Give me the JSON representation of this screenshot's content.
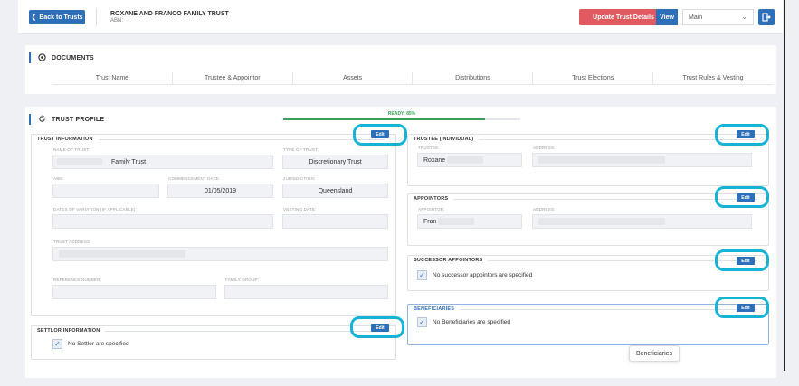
{
  "header": {
    "back_label": "Back to Trusts",
    "trust_title": "ROXANE AND FRANCO FAMILY TRUST",
    "abn_label": "ABN:",
    "update_label": "Update Trust Details",
    "view_label": "View",
    "view_selected": "Main"
  },
  "documents": {
    "title": "DOCUMENTS",
    "tabs": [
      "Trust Name",
      "Trustee & Appointor",
      "Assets",
      "Distributions",
      "Trust Elections",
      "Trust Rules & Vesting"
    ]
  },
  "profile": {
    "title": "TRUST PROFILE",
    "ready_label": "READY: 85%",
    "ready_value": 0.85
  },
  "trust_info": {
    "title": "TRUST INFORMATION",
    "edit_label": "Edit",
    "name_label": "NAME OF TRUST:",
    "name_value": "Family Trust",
    "type_label": "TYPE OF TRUST:",
    "type_value": "Discretionary Trust",
    "abn_label": "ABN:",
    "commencement_label": "COMMENCEMENT DATE:",
    "commencement_value": "01/05/2019",
    "jurisdiction_label": "JURISDICTION:",
    "jurisdiction_value": "Queensland",
    "variation_label": "DATES OF VARIATION (IF APPLICABLE):",
    "vesting_label": "VESTING DATE:",
    "address_label": "TRUST ADDRESS:",
    "reference_label": "REFERENCE NUMBER:",
    "family_group_label": "FAMILY GROUP:"
  },
  "settlor": {
    "title": "SETTLOR INFORMATION",
    "edit_label": "Edit",
    "none_text": "No Settlor are specified"
  },
  "trustee": {
    "title": "TRUSTEE (INDIVIDUAL)",
    "edit_label": "Edit",
    "trustee_label": "TRUSTEE:",
    "trustee_value": "Roxane",
    "address_label": "ADDRESS:"
  },
  "appointors": {
    "title": "APPOINTORS",
    "edit_label": "Edit",
    "appointor_label": "APPOINTOR:",
    "appointor_value": "Fran",
    "address_label": "ADDRESS:"
  },
  "successor": {
    "title": "SUCCESSOR APPOINTORS",
    "edit_label": "Edit",
    "none_text": "No successor appointors are specified"
  },
  "beneficiaries": {
    "title": "BENEFICIARIES",
    "edit_label": "Edit",
    "none_text": "No Beneficiaries are specified",
    "tooltip": "Beneficiaries"
  },
  "colors": {
    "primary": "#2d6fb8",
    "danger": "#e05a5f",
    "success": "#3aa05a",
    "highlight": "#16b3d6"
  }
}
